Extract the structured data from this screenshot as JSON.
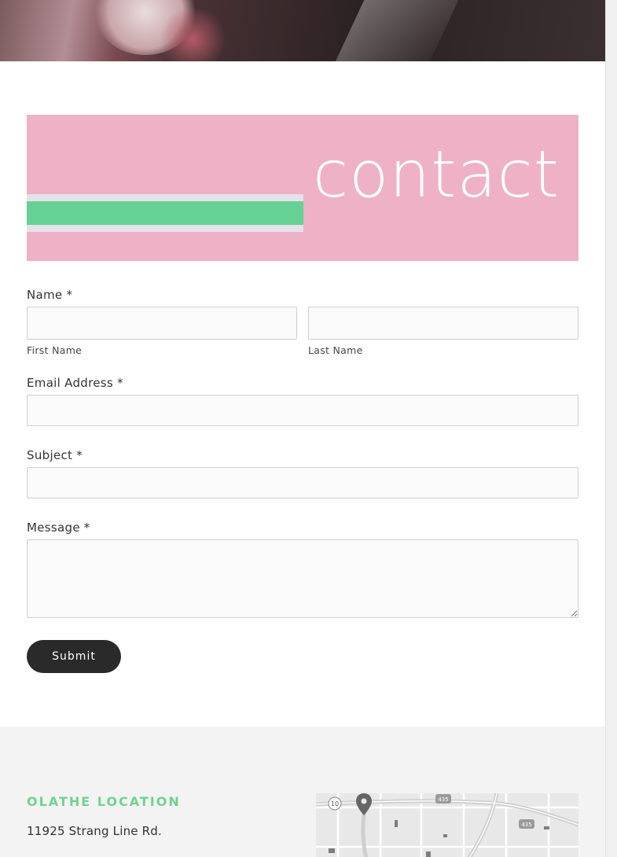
{
  "banner": {
    "word": "contact"
  },
  "form": {
    "name_label": "Name",
    "required_mark": "*",
    "first_name_sublabel": "First Name",
    "last_name_sublabel": "Last Name",
    "first_name_value": "",
    "last_name_value": "",
    "email_label": "Email Address",
    "email_value": "",
    "subject_label": "Subject",
    "subject_value": "",
    "message_label": "Message",
    "message_value": "",
    "submit_label": "Submit"
  },
  "footer": {
    "location_title": "OLATHE LOCATION",
    "address_line1": "11925 Strang Line Rd.",
    "map": {
      "highway_shields": [
        "10",
        "435",
        "435"
      ],
      "marker_icon": "map-pin-icon"
    }
  },
  "colors": {
    "banner_pink": "#efb1c5",
    "banner_green": "#66d195",
    "location_green": "#6fd38e",
    "button_dark": "#2a2a2a"
  }
}
